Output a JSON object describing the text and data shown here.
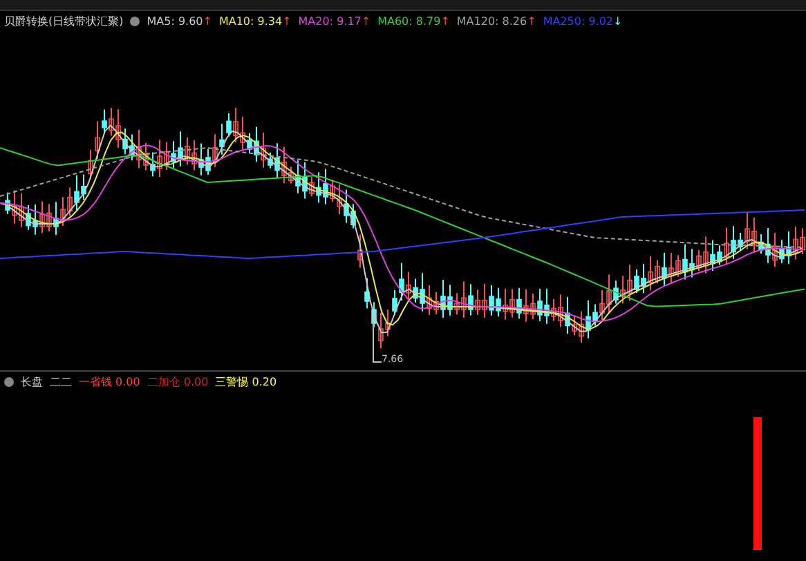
{
  "main_panel": {
    "title": "贝爵转换(日线带状汇聚)",
    "moving_averages": [
      {
        "label": "MA5: 9.60",
        "arrow": "↑",
        "color": "#c8c8c8"
      },
      {
        "label": "MA10: 9.34",
        "arrow": "↑",
        "color": "#e8e848"
      },
      {
        "label": "MA20: 9.17",
        "arrow": "↑",
        "color": "#e040e0"
      },
      {
        "label": "MA60: 8.79",
        "arrow": "↑",
        "color": "#30d030"
      },
      {
        "label": "MA120: 8.26",
        "arrow": "↑",
        "color": "#a0a0a0"
      },
      {
        "label": "MA250: 9.02",
        "arrow": "↓",
        "color": "#3040ff"
      }
    ],
    "low_label": "7.66"
  },
  "indicator_panel": {
    "title": "长盘",
    "items": [
      {
        "label": "二二",
        "value": "",
        "color": "#c0c0c0"
      },
      {
        "label": "一省钱",
        "value": "0.00",
        "color": "#ff4040"
      },
      {
        "label": "二加仓",
        "value": "0.00",
        "color": "#e02020"
      },
      {
        "label": "三警惕",
        "value": "0.20",
        "color": "#ffff40"
      }
    ]
  }
}
